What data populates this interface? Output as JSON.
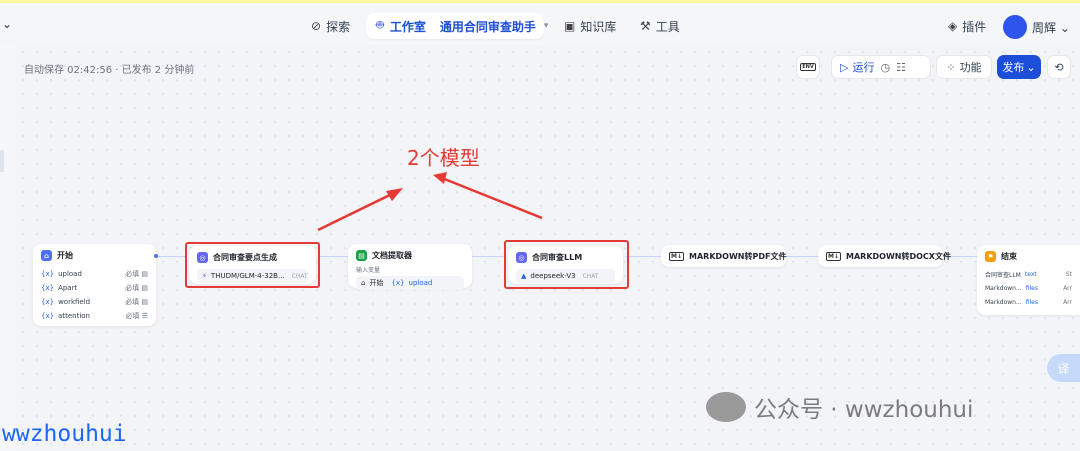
{
  "topbar": {
    "explore": "探索",
    "studio": "工作室",
    "app_name": "通用合同审查助手",
    "knowledge": "知识库",
    "tools": "工具",
    "plugins": "插件",
    "user": "周辉"
  },
  "toolbar": {
    "autosave": "自动保存 02:42:56 · 已发布 2 分钟前",
    "env": "ENV",
    "run": "运行",
    "features": "功能",
    "publish": "发布"
  },
  "annotation": "2个模型",
  "nodes": {
    "start": {
      "title": "开始",
      "vars": [
        {
          "name": "upload",
          "req": "必填"
        },
        {
          "name": "Apart",
          "req": "必填"
        },
        {
          "name": "workfield",
          "req": "必填"
        },
        {
          "name": "attention",
          "req": "必填"
        }
      ]
    },
    "gen": {
      "title": "合同审查要点生成",
      "model": "THUDM/GLM-4-32B...",
      "mode": "CHAT"
    },
    "extract": {
      "title": "文档提取器",
      "input_label": "输入变量",
      "src": "开始",
      "var": "upload"
    },
    "llm": {
      "title": "合同审查LLM",
      "model": "deepseek-V3",
      "mode": "CHAT"
    },
    "pdf": {
      "title": "MARKDOWN转PDF文件"
    },
    "docx": {
      "title": "MARKDOWN转DOCX文件"
    },
    "end": {
      "title": "结束",
      "rows": [
        {
          "src": "合同审查LLM",
          "var": "text",
          "extra": "St"
        },
        {
          "src": "Markdown...",
          "var": "files",
          "extra": "Arr"
        },
        {
          "src": "Markdown...",
          "var": "files",
          "extra": "Arr"
        }
      ]
    }
  },
  "translate_btn": "译",
  "watermark": {
    "wechat": "公众号 · wwzhouhui",
    "bottom": "wwzhouhui"
  }
}
